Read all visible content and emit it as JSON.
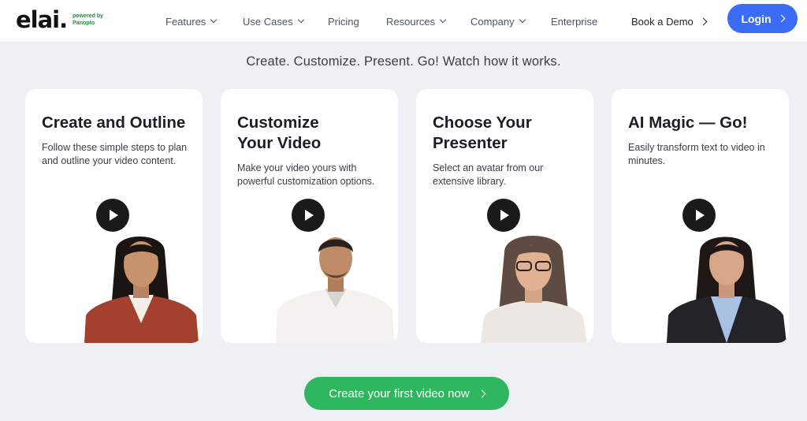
{
  "brand": {
    "logo_text": "elai.",
    "powered_by": "powered by Panopto"
  },
  "nav": {
    "items": [
      {
        "label": "Features",
        "has_dropdown": true
      },
      {
        "label": "Use Cases",
        "has_dropdown": true
      },
      {
        "label": "Pricing",
        "has_dropdown": false
      },
      {
        "label": "Resources",
        "has_dropdown": true
      },
      {
        "label": "Company",
        "has_dropdown": true
      },
      {
        "label": "Enterprise",
        "has_dropdown": false
      }
    ],
    "book_demo": "Book a Demo",
    "login": "Login"
  },
  "hero": {
    "tagline": "Create. Customize. Present. Go! Watch how it works."
  },
  "cards": [
    {
      "title": "Create and Outline",
      "description": "Follow these simple steps to plan and outline your video content.",
      "avatar": "woman-red-top"
    },
    {
      "title": "Customize Your Video",
      "description": "Make your video yours with powerful customization options.",
      "avatar": "man-white-shirt"
    },
    {
      "title": "Choose Your Presenter",
      "description": "Select an avatar from our extensive library.",
      "avatar": "woman-glasses"
    },
    {
      "title": "AI Magic — Go!",
      "description": "Easily transform text to video in minutes.",
      "avatar": "woman-blazer"
    }
  ],
  "cta": {
    "label": "Create your first video now"
  },
  "colors": {
    "login_bg": "#3b6cf6",
    "cta_bg": "#2fb760",
    "page_bg": "#eef0f3",
    "brand_green": "#1f8a44"
  }
}
